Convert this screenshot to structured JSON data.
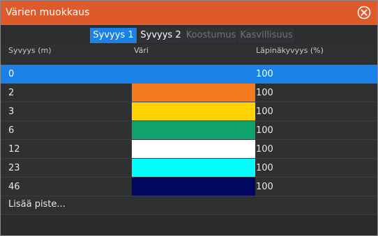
{
  "window": {
    "title": "Värien muokkaus",
    "close_icon": "close-circle-icon"
  },
  "tabs": [
    {
      "label": "Syvyys 1",
      "state": "active"
    },
    {
      "label": "Syvyys 2",
      "state": "enabled"
    },
    {
      "label": "Koostumus",
      "state": "disabled"
    },
    {
      "label": "Kasvillisuus",
      "state": "disabled"
    }
  ],
  "table": {
    "headers": {
      "depth": "Syvyys (m)",
      "color": "Väri",
      "transparency": "Läpinäkyvyys (%)"
    },
    "rows": [
      {
        "depth": "0",
        "color": "#1a82e6",
        "transparency": "100",
        "selected": true
      },
      {
        "depth": "2",
        "color": "#f47b20",
        "transparency": "100",
        "selected": false
      },
      {
        "depth": "3",
        "color": "#ffd200",
        "transparency": "100",
        "selected": false
      },
      {
        "depth": "6",
        "color": "#0fa36b",
        "transparency": "100",
        "selected": false
      },
      {
        "depth": "12",
        "color": "#ffffff",
        "transparency": "100",
        "selected": false
      },
      {
        "depth": "23",
        "color": "#00ffff",
        "transparency": "100",
        "selected": false
      },
      {
        "depth": "46",
        "color": "#00085f",
        "transparency": "100",
        "selected": false
      }
    ],
    "add_point_label": "Lisää piste..."
  },
  "colors": {
    "title_bar": "#df5a2a",
    "accent": "#1a82e6",
    "background": "#2e3032"
  }
}
